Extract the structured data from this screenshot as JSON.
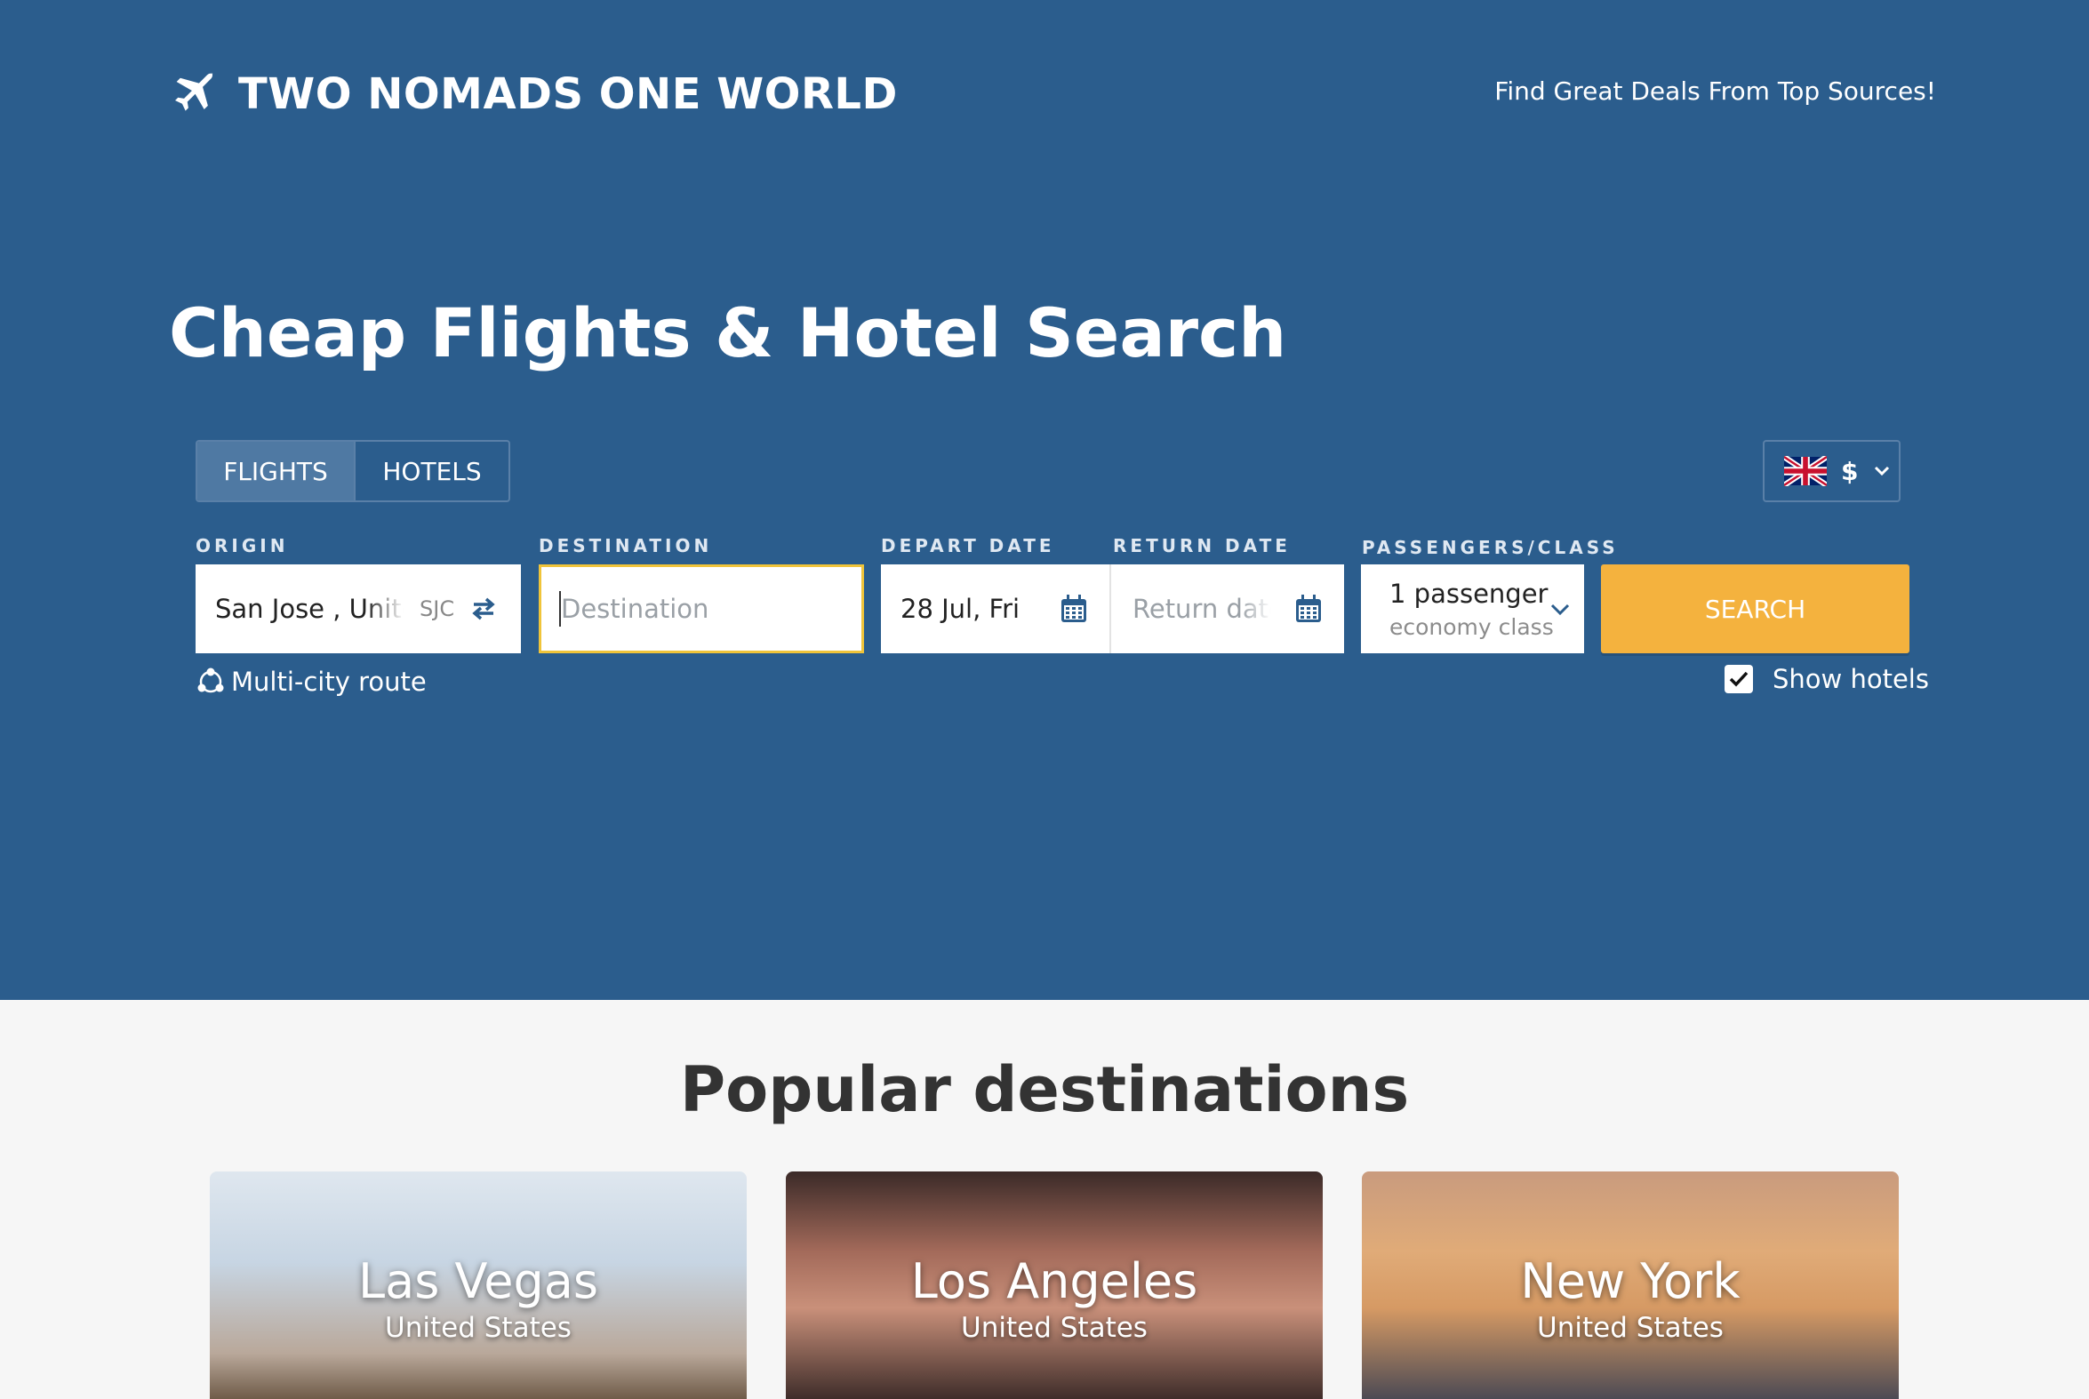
{
  "header": {
    "brand_name": "TWO NOMADS ONE WORLD",
    "tagline": "Find Great Deals From Top Sources!"
  },
  "hero": {
    "title": "Cheap Flights & Hotel Search"
  },
  "tabs": [
    {
      "label": "FLIGHTS",
      "active": true
    },
    {
      "label": "HOTELS",
      "active": false
    }
  ],
  "currency": {
    "flag_icon": "uk-flag-icon",
    "symbol": "$"
  },
  "form": {
    "origin": {
      "label": "ORIGIN",
      "value": "San Jose , United States",
      "code": "SJC"
    },
    "destination": {
      "label": "DESTINATION",
      "value": "",
      "placeholder": "Destination"
    },
    "depart": {
      "label": "DEPART DATE",
      "value": "28 Jul, Fri"
    },
    "return": {
      "label": "RETURN DATE",
      "value": "",
      "placeholder": "Return date"
    },
    "passengers": {
      "label": "PASSENGERS/CLASS",
      "count": "1 passenger",
      "class": "economy class"
    },
    "search_label": "SEARCH",
    "multi_city_label": "Multi-city route",
    "show_hotels_label": "Show hotels",
    "show_hotels_checked": true
  },
  "popular": {
    "title": "Popular destinations",
    "cards": [
      {
        "city": "Las Vegas",
        "country": "United States"
      },
      {
        "city": "Los Angeles",
        "country": "United States"
      },
      {
        "city": "New York",
        "country": "United States"
      }
    ]
  },
  "colors": {
    "hero_bg": "#2b5d8d",
    "accent": "#f4b23e",
    "focus_border": "#f0c43a"
  }
}
